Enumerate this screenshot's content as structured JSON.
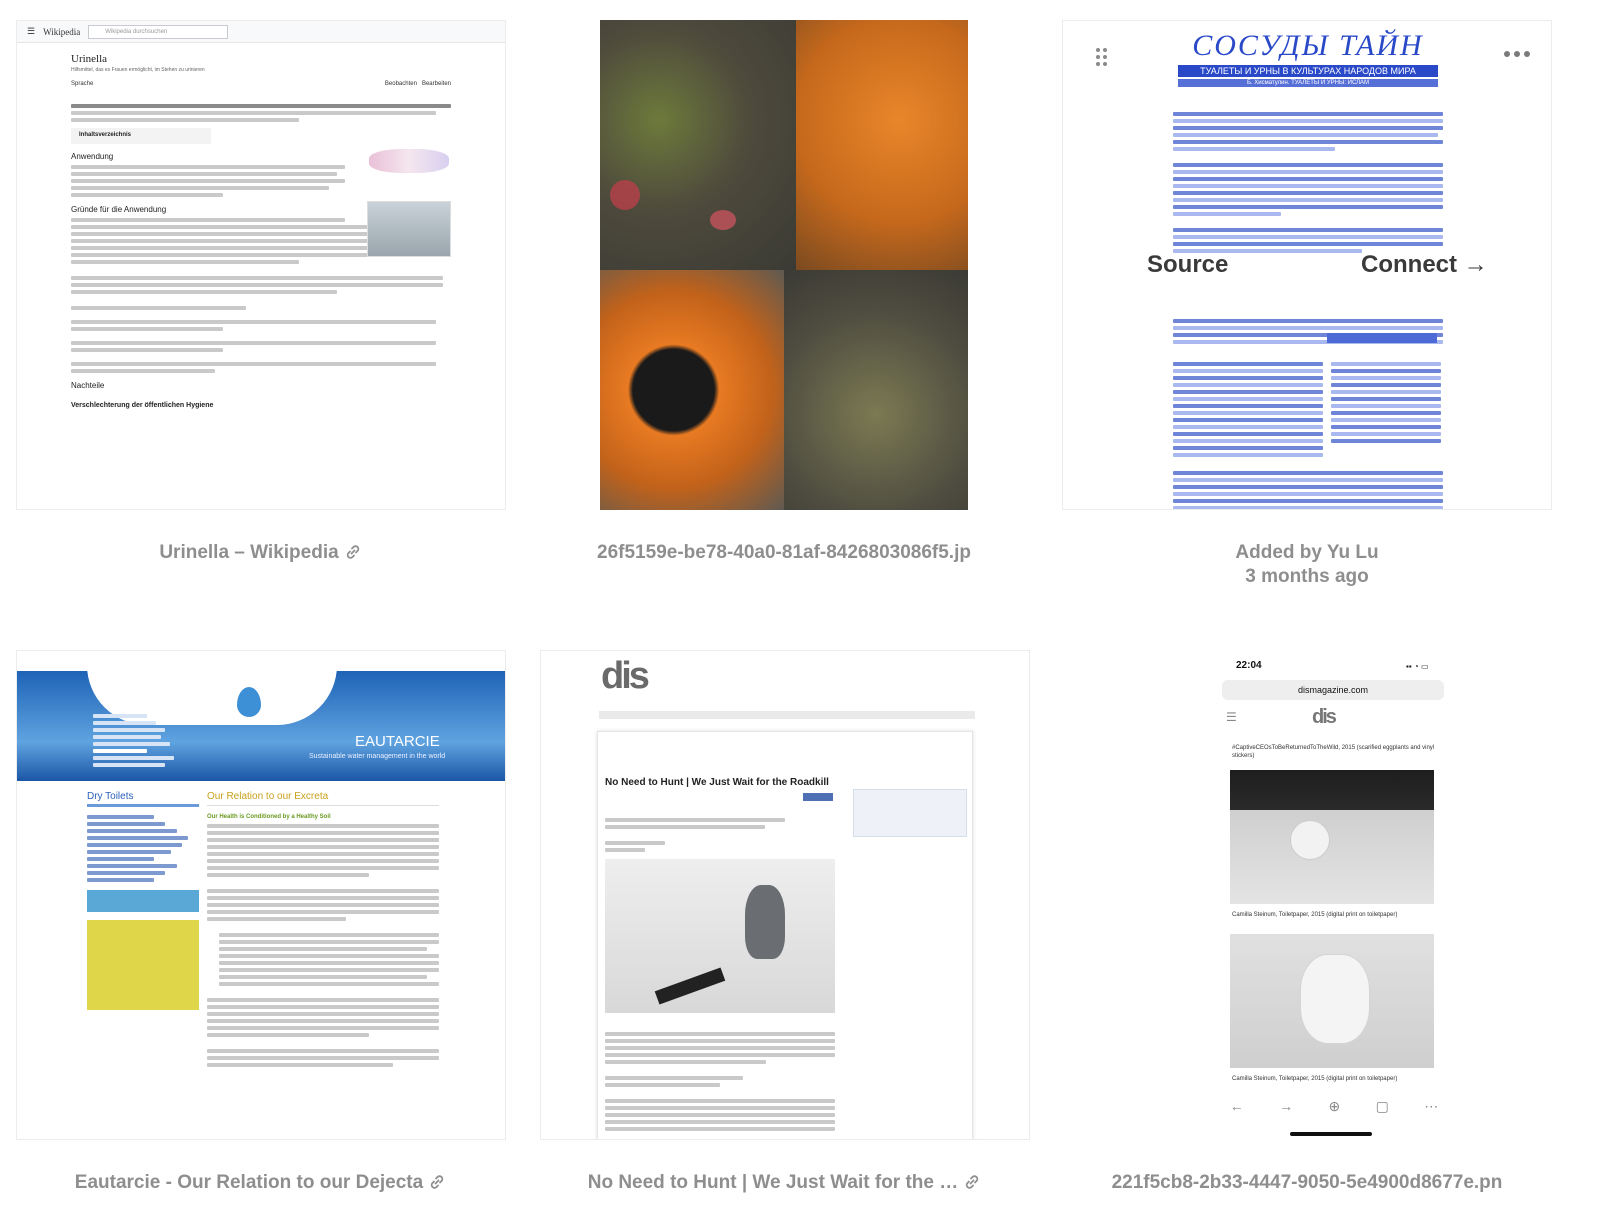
{
  "cards": [
    {
      "caption": "Urinella – Wikipedia",
      "has_link": true,
      "wiki": {
        "brand": "Wikipedia",
        "search_placeholder": "Wikipedia durchsuchen",
        "title": "Urinella",
        "subtitle": "Hilfsmittel, das es Frauen ermöglicht, im Stehen zu urinieren",
        "language": "Sprache",
        "watch": "Beobachten",
        "edit": "Bearbeiten",
        "toc": "Inhaltsverzeichnis",
        "section_use": "Anwendung",
        "section_reasons": "Gründe für die Anwendung",
        "section_drawbacks": "Nachteile",
        "sub_drawback": "Verschlechterung der öffentlichen Hygiene"
      }
    },
    {
      "caption": "26f5159e-be78-40a0-81af-8426803086f5.jp",
      "has_link": false
    },
    {
      "caption_line1": "Added by Yu Lu",
      "caption_line2": "3 months ago",
      "doc": {
        "title": "СОСУДЫ ТАЙН",
        "banner": "ТУАЛЕТЫ И УРНЫ В КУЛЬТУРАХ НАРОДОВ МИРА",
        "subbanner": "Б. Хисматулин. ТУАЛЕТЫ И УРНЫ: ИСЛАМ"
      },
      "overlay": {
        "source_label": "Source",
        "connect_label": "Connect →"
      }
    },
    {
      "caption": "Eautarcie - Our Relation to our Dejecta",
      "has_link": true,
      "site": {
        "name": "EAUTARCIE",
        "tagline": "Sustainable water management in the world",
        "side_title": "Dry Toilets",
        "main_title": "Our Relation to our Excreta",
        "subhead": "Our Health is Conditioned by a Healthy Soil"
      }
    },
    {
      "caption": "No Need to Hunt | We Just Wait for the …",
      "has_link": true,
      "site": {
        "logo": "dis",
        "headline": "No Need to Hunt | We Just Wait for the Roadkill"
      }
    },
    {
      "caption": "221f5cb8-2b33-4447-9050-5e4900d8677e.pn",
      "has_link": false,
      "phone": {
        "time": "22:04",
        "url": "dismagazine.com",
        "caption1": "#CaptiveCEOsToBeReturnedToTheWild, 2015 (scarified eggplants and vinyl stickers)",
        "caption2": "Camilla Steinum, Toiletpaper, 2015 (digital print on toiletpaper)",
        "caption3": "Camilla Steinum, Toiletpaper, 2015 (digital print on toiletpaper)"
      }
    }
  ],
  "icon_names": [
    "link-icon",
    "drag-handle-icon",
    "more-options-icon"
  ]
}
